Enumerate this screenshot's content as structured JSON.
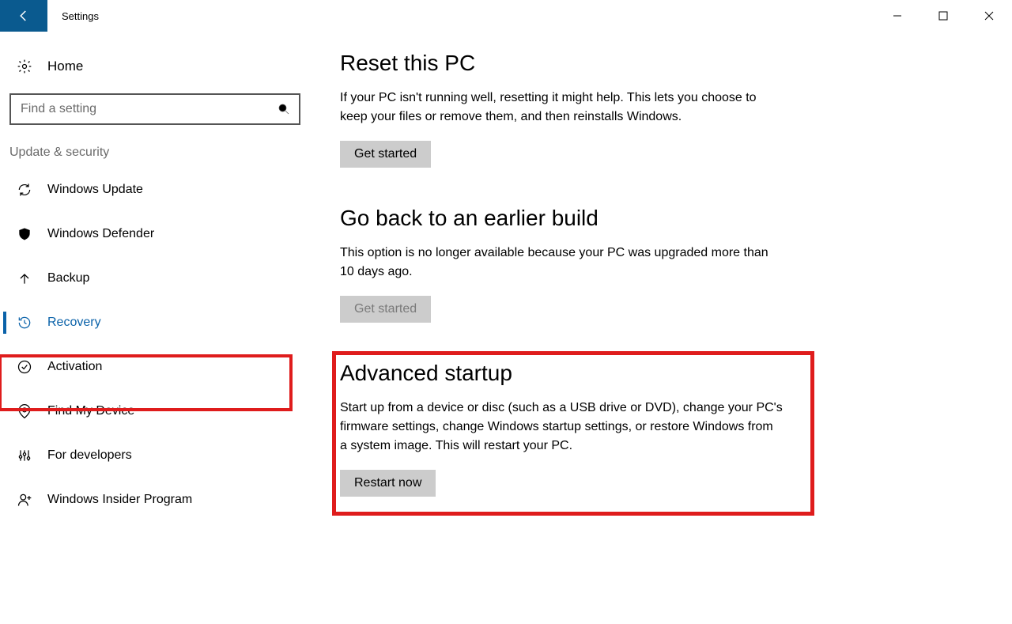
{
  "titlebar": {
    "title": "Settings"
  },
  "sidebar": {
    "home_label": "Home",
    "search_placeholder": "Find a setting",
    "category_label": "Update & security",
    "items": [
      {
        "label": "Windows Update"
      },
      {
        "label": "Windows Defender"
      },
      {
        "label": "Backup"
      },
      {
        "label": "Recovery"
      },
      {
        "label": "Activation"
      },
      {
        "label": "Find My Device"
      },
      {
        "label": "For developers"
      },
      {
        "label": "Windows Insider Program"
      }
    ]
  },
  "sections": {
    "reset": {
      "title": "Reset this PC",
      "desc": "If your PC isn't running well, resetting it might help. This lets you choose to keep your files or remove them, and then reinstalls Windows.",
      "button": "Get started"
    },
    "goback": {
      "title": "Go back to an earlier build",
      "desc": "This option is no longer available because your PC was upgraded more than 10 days ago.",
      "button": "Get started"
    },
    "advanced": {
      "title": "Advanced startup",
      "desc": "Start up from a device or disc (such as a USB drive or DVD), change your PC's firmware settings, change Windows startup settings, or restore Windows from a system image. This will restart your PC.",
      "button": "Restart now"
    }
  }
}
